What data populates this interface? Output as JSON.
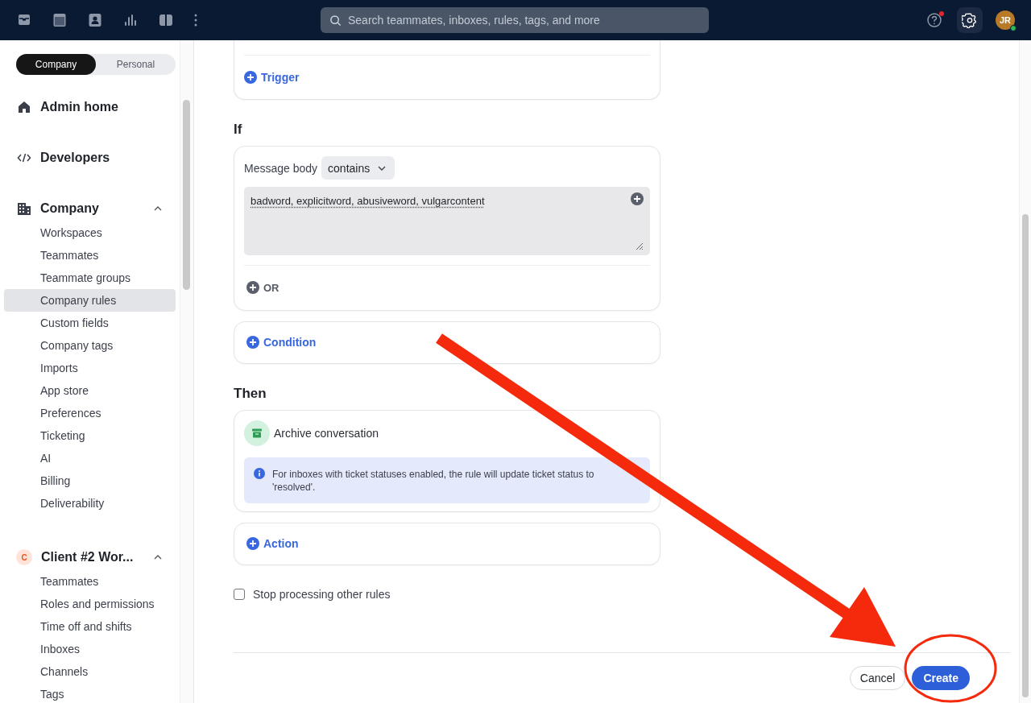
{
  "topbar": {
    "search": {
      "placeholder": "Search teammates, inboxes, rules, tags, and more"
    },
    "help": {
      "has_notification": true
    },
    "avatar": {
      "initials": "JR",
      "online": true
    }
  },
  "sidebar": {
    "scope_toggle": [
      {
        "label": "Company",
        "selected": true
      },
      {
        "label": "Personal",
        "selected": false
      }
    ],
    "sections": [
      {
        "kind": "home",
        "label": "Admin home"
      },
      {
        "kind": "code",
        "label": "Developers"
      },
      {
        "kind": "building",
        "label": "Company",
        "expanded": true,
        "children": [
          {
            "label": "Workspaces",
            "selected": false
          },
          {
            "label": "Teammates",
            "selected": false
          },
          {
            "label": "Teammate groups",
            "selected": false
          },
          {
            "label": "Company rules",
            "selected": true
          },
          {
            "label": "Custom fields",
            "selected": false
          },
          {
            "label": "Company tags",
            "selected": false
          },
          {
            "label": "Imports",
            "selected": false
          },
          {
            "label": "App store",
            "selected": false
          },
          {
            "label": "Preferences",
            "selected": false
          },
          {
            "label": "Ticketing",
            "selected": false
          },
          {
            "label": "AI",
            "selected": false
          },
          {
            "label": "Billing",
            "selected": false
          },
          {
            "label": "Deliverability",
            "selected": false
          }
        ]
      },
      {
        "kind": "workspace",
        "badge": "C",
        "label": "Client #2 Wor...",
        "expanded": true,
        "children": [
          {
            "label": "Teammates",
            "selected": false
          },
          {
            "label": "Roles and permissions",
            "selected": false
          },
          {
            "label": "Time off and shifts",
            "selected": false
          },
          {
            "label": "Inboxes",
            "selected": false
          },
          {
            "label": "Channels",
            "selected": false
          },
          {
            "label": "Tags",
            "selected": false
          }
        ]
      }
    ]
  },
  "main": {
    "trigger_card": {
      "add_label": "Trigger"
    },
    "if": {
      "heading": "If",
      "condition": {
        "field": "Message body",
        "operator": "contains",
        "value": "badword, explicitword, abusiveword, vulgarcontent"
      },
      "or_label": "OR",
      "add_label": "Condition"
    },
    "then": {
      "heading": "Then",
      "action": {
        "label": "Archive conversation",
        "note": "For inboxes with ticket statuses enabled, the rule will update ticket status to 'resolved'."
      },
      "add_label": "Action"
    },
    "stop_processing": {
      "label": "Stop processing other rules",
      "checked": false
    },
    "buttons": {
      "cancel": "Cancel",
      "create": "Create"
    }
  }
}
